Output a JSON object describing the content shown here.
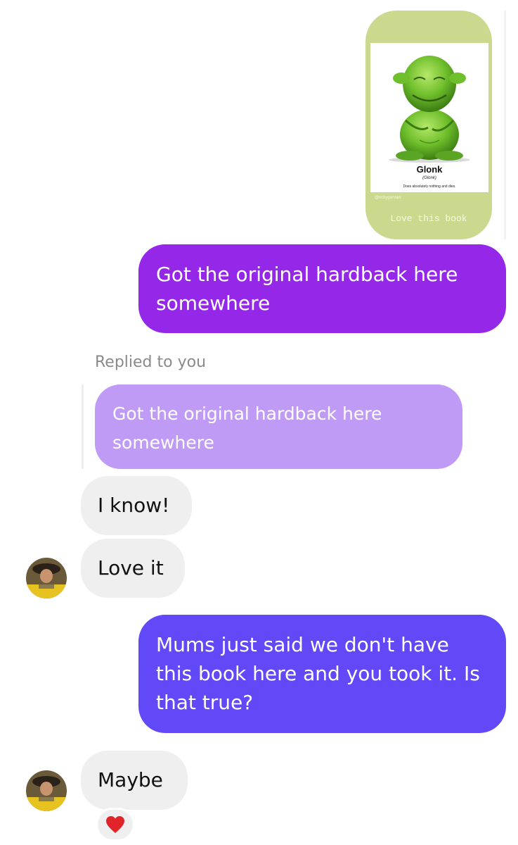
{
  "story": {
    "book_title": "Glonk",
    "book_subtitle": "(Glonk)",
    "book_description": "Does absolutely nothing and dies.",
    "credit": "@rickygervais",
    "caption": "Love this book"
  },
  "messages": {
    "sent_1": "Got the original hardback here somewhere",
    "reply_label": "Replied to you",
    "quoted": "Got the original hardback here somewhere",
    "received_1": "I know!",
    "received_2": "Love it",
    "sent_2": "Mums just said we don't have this book here and you took it. Is that true?",
    "received_3": "Maybe"
  },
  "reaction": {
    "icon": "heart-icon",
    "color": "#e0242a"
  },
  "colors": {
    "sent_1_bg": "#9528e8",
    "sent_2_bg": "#6249f7",
    "quoted_bg": "#c09bf6",
    "received_bg": "#efefef",
    "story_bg": "#cbd98f"
  }
}
